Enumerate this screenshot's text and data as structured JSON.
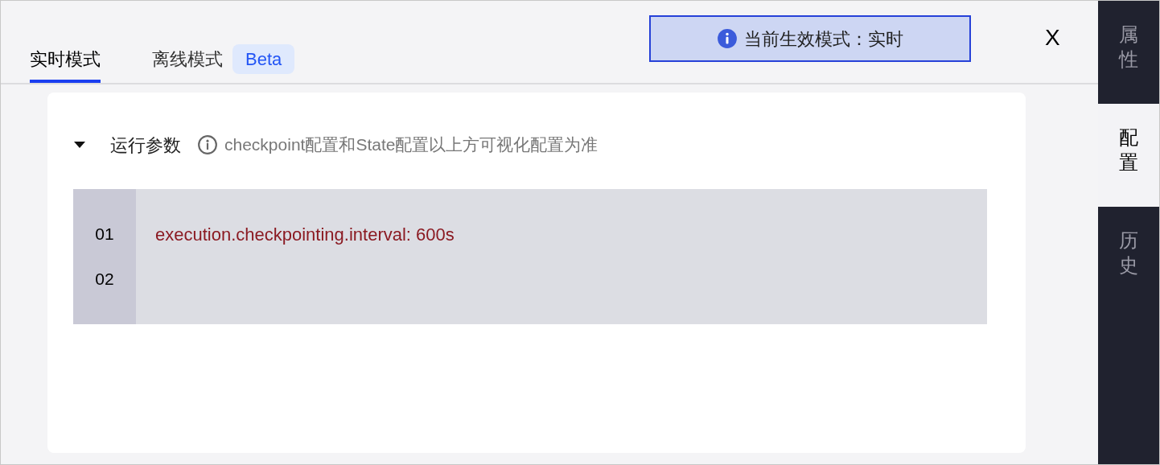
{
  "tabs": [
    {
      "label": "实时模式",
      "selected": true
    },
    {
      "label": "离线模式",
      "selected": false,
      "badge": "Beta"
    }
  ],
  "mode_banner": {
    "text": "当前生效模式：实时"
  },
  "close": {
    "label": "X"
  },
  "section": {
    "title": "运行参数",
    "expanded": true,
    "hint": "checkpoint配置和State配置以上方可视化配置为准"
  },
  "code_lines": [
    {
      "number": "01",
      "text": "execution.checkpointing.interval: 600s"
    },
    {
      "number": "02"
    }
  ],
  "side_tabs": [
    {
      "label": "属性",
      "selected": false
    },
    {
      "label": "配置",
      "selected": true
    },
    {
      "label": "历史",
      "selected": false
    }
  ]
}
